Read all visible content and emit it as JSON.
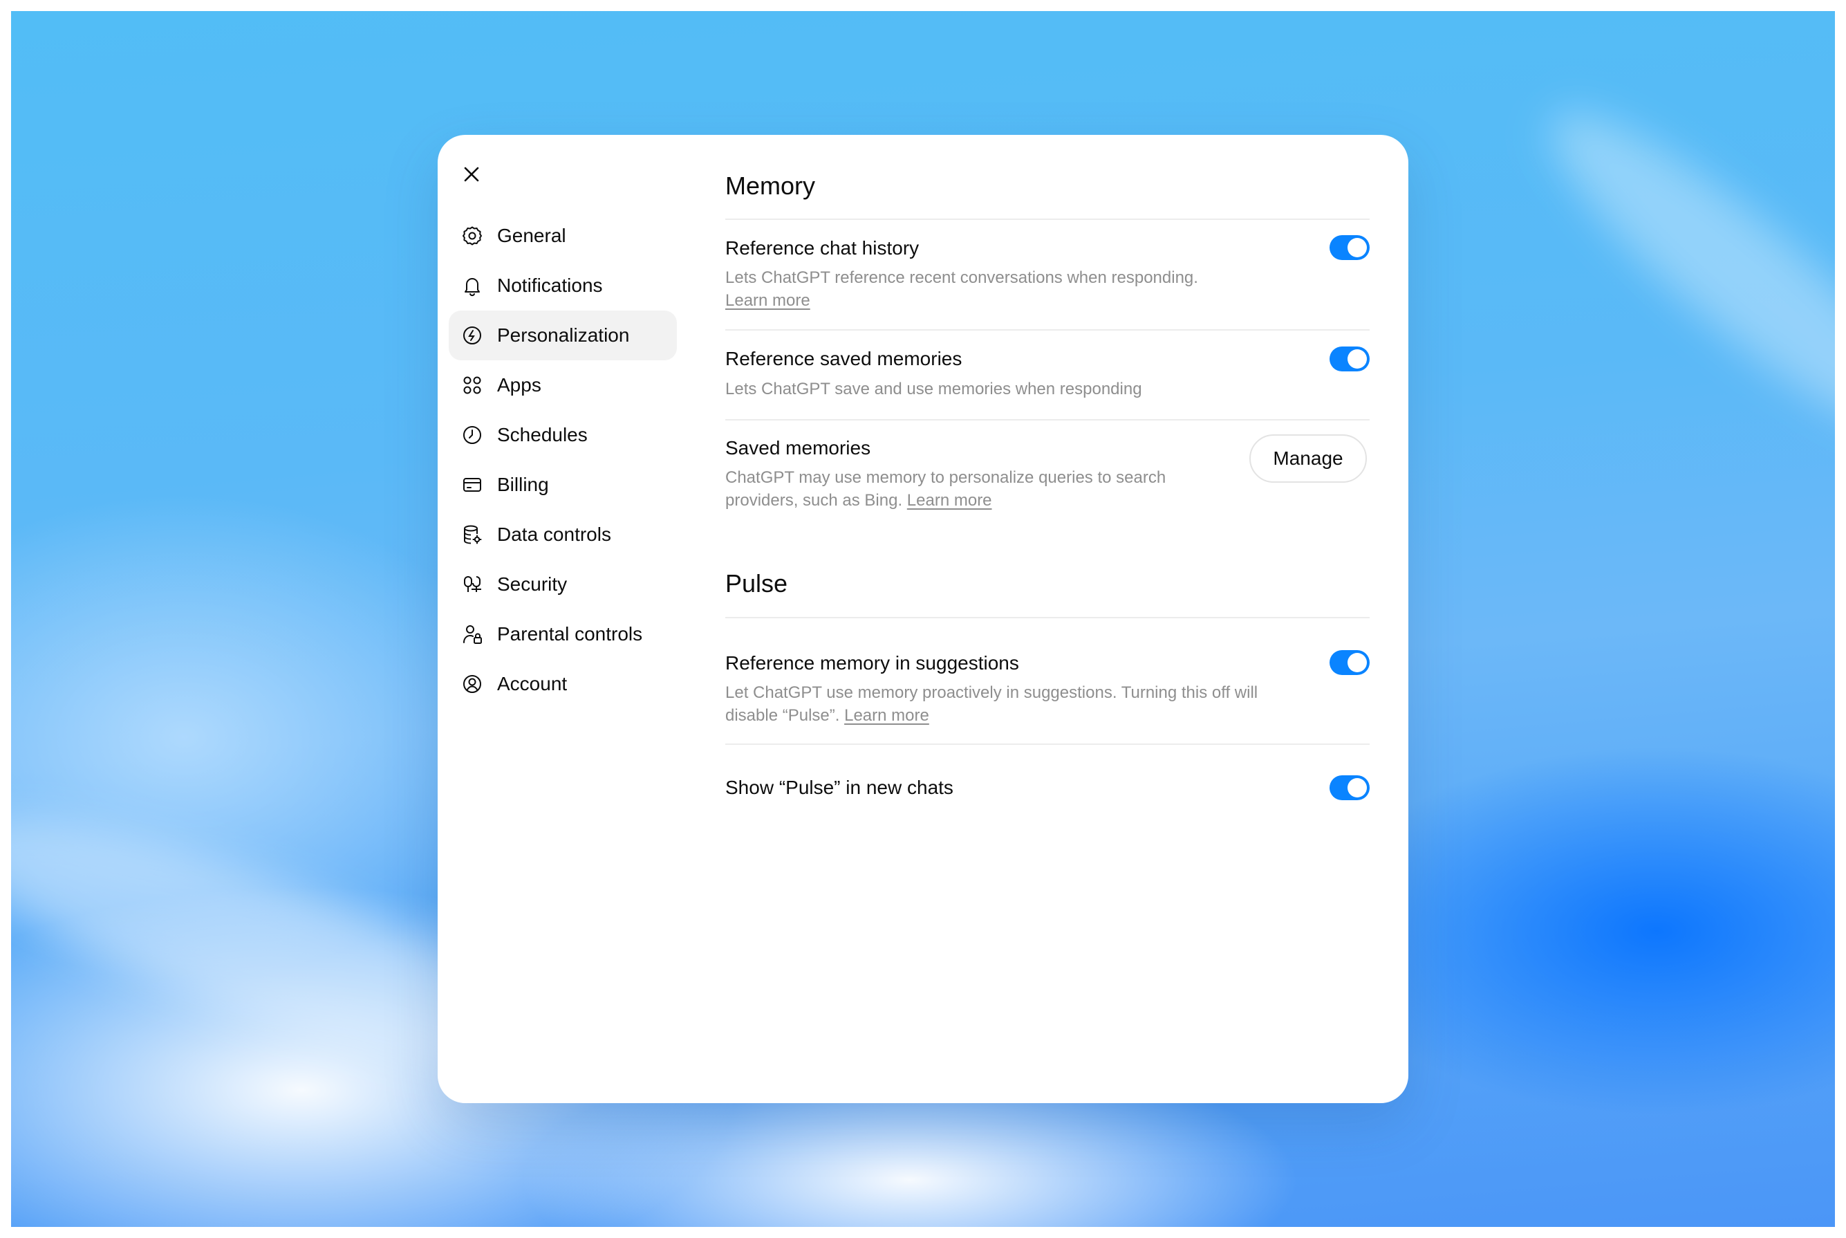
{
  "nav": {
    "items": [
      {
        "label": "General",
        "icon": "gear-icon"
      },
      {
        "label": "Notifications",
        "icon": "bell-icon"
      },
      {
        "label": "Personalization",
        "icon": "personalization-icon",
        "active": true
      },
      {
        "label": "Apps",
        "icon": "apps-grid-icon"
      },
      {
        "label": "Schedules",
        "icon": "clock-icon"
      },
      {
        "label": "Billing",
        "icon": "credit-card-icon"
      },
      {
        "label": "Data controls",
        "icon": "database-icon"
      },
      {
        "label": "Security",
        "icon": "shield-icon"
      },
      {
        "label": "Parental controls",
        "icon": "parent-lock-icon"
      },
      {
        "label": "Account",
        "icon": "user-circle-icon"
      }
    ]
  },
  "memory": {
    "title": "Memory",
    "reference_chat_history": {
      "title": "Reference chat history",
      "desc": "Lets ChatGPT reference recent conversations when responding.",
      "link": "Learn more",
      "enabled": true
    },
    "reference_saved_memories": {
      "title": "Reference saved memories",
      "desc": "Lets ChatGPT save and use memories when responding",
      "enabled": true
    },
    "saved_memories": {
      "title": "Saved memories",
      "desc_line1": "ChatGPT may use memory to personalize queries to search",
      "desc_line2": "providers, such as Bing.",
      "link": "Learn more",
      "button": "Manage"
    }
  },
  "pulse": {
    "title": "Pulse",
    "reference_memory_in_suggestions": {
      "title": "Reference memory in suggestions",
      "desc_line1": "Let ChatGPT use memory proactively in suggestions. Turning this off will",
      "desc_line2": "disable “Pulse”.",
      "link": "Learn more",
      "enabled": true
    },
    "show_pulse": {
      "title": "Show “Pulse” in new chats",
      "enabled": true
    }
  },
  "colors": {
    "toggle_on": "#0a84ff",
    "active_nav_bg": "#f2f2f2",
    "muted_text": "#8e8e8e"
  }
}
